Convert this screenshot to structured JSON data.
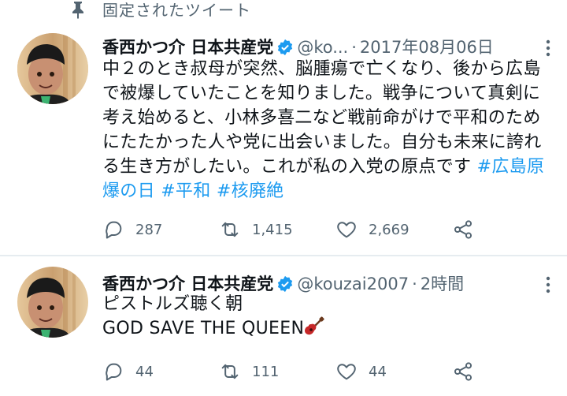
{
  "pinned": {
    "label": "固定されたツイート"
  },
  "tweets": [
    {
      "display_name": "香西かつ介 日本共産党",
      "handle": "@ko...",
      "separator": "·",
      "time": "2017年08月06日",
      "body_plain": "中２のとき叔母が突然、脳腫瘍で亡くなり、後から広島で被爆していたことを知りました。戦争について真剣に考え始めると、小林多喜二など戦前命がけで平和のためにたたかった人や党に出会いました。自分も未来に誇れる生き方がしたい。これが私の入党の原点です ",
      "hashtags": [
        "#広島原爆の日",
        "#平和",
        "#核廃絶"
      ],
      "replies": "287",
      "retweets": "1,415",
      "likes": "2,669"
    },
    {
      "display_name": "香西かつ介 日本共産党",
      "handle": "@kouzai2007",
      "separator": "·",
      "time": "2時間",
      "line1": "ピストルズ聴く朝",
      "line2": "GOD SAVE THE QUEEN",
      "emoji": "guitar",
      "replies": "44",
      "retweets": "111",
      "likes": "44"
    }
  ],
  "colors": {
    "text": "#0f1419",
    "secondary": "#536471",
    "link": "#1d9bf0",
    "verified": "#1d9bf0",
    "divider": "#e6ecf0"
  }
}
